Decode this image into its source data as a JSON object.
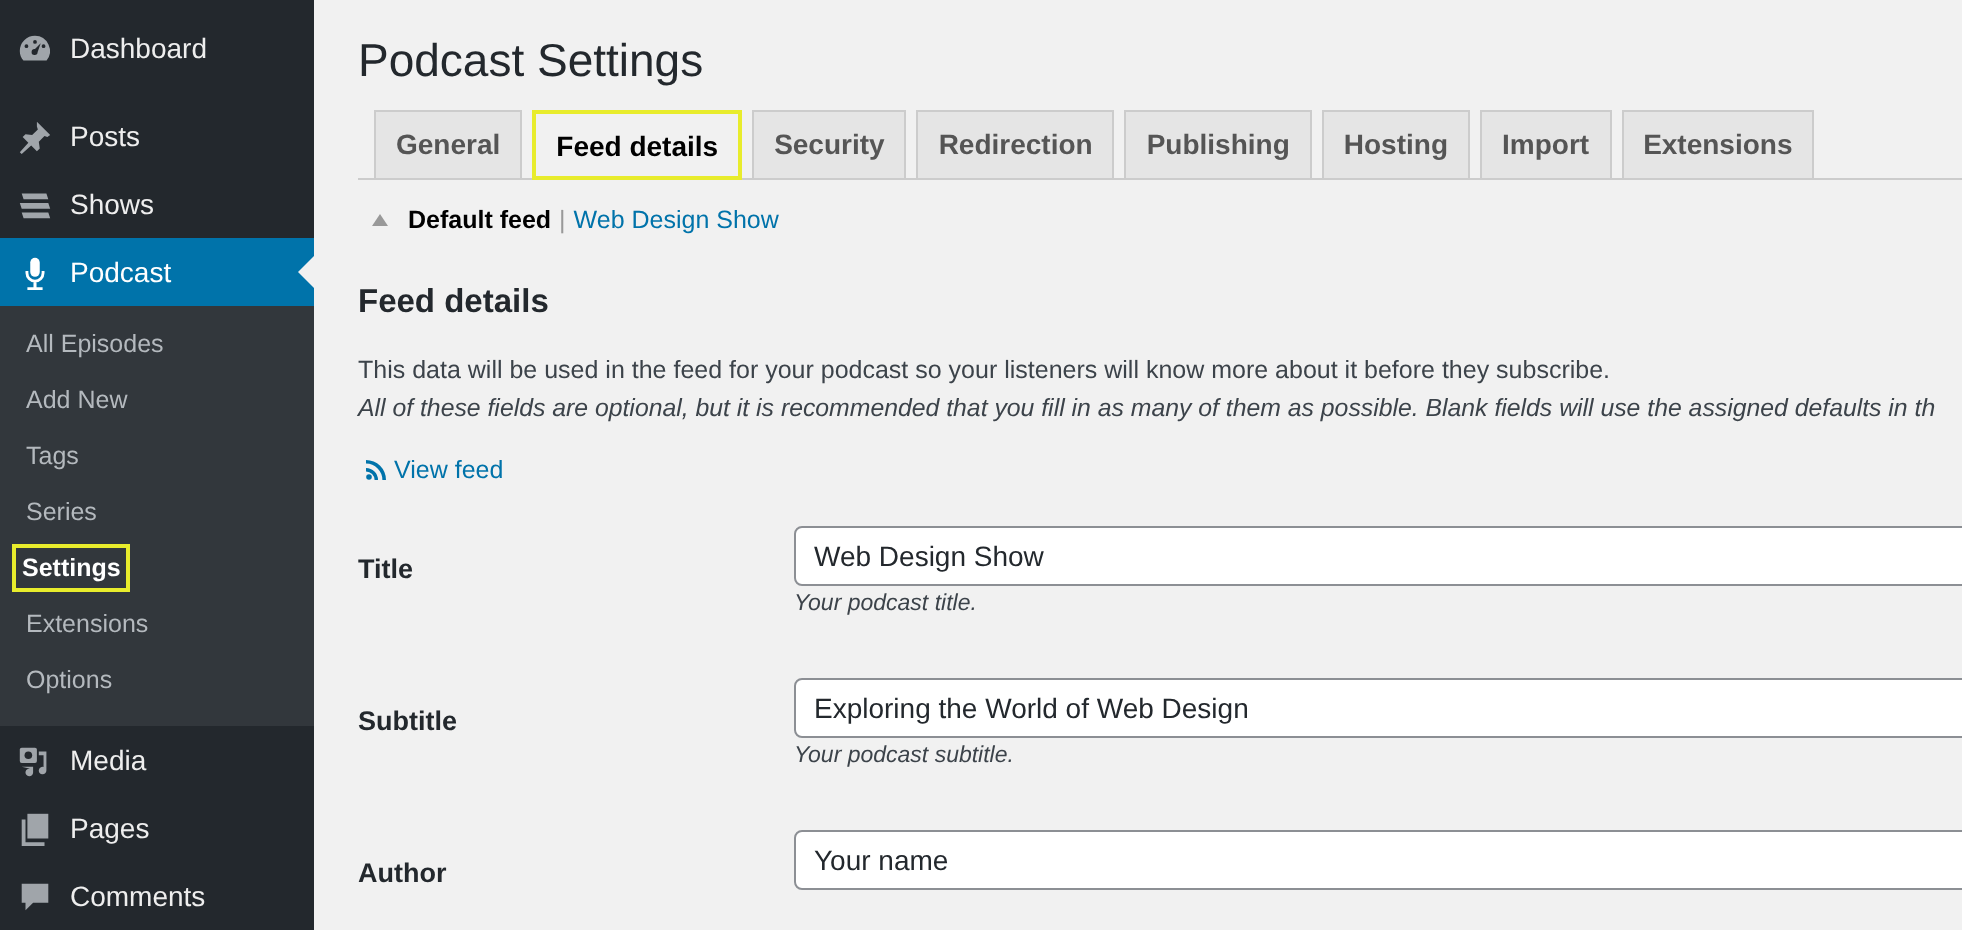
{
  "sidebar": {
    "items": [
      {
        "label": "Dashboard",
        "selected": false
      },
      {
        "label": "Posts",
        "selected": false
      },
      {
        "label": "Shows",
        "selected": false
      },
      {
        "label": "Podcast",
        "selected": true,
        "children": [
          {
            "label": "All Episodes",
            "selected": false,
            "highlighted": false
          },
          {
            "label": "Add New",
            "selected": false,
            "highlighted": false
          },
          {
            "label": "Tags",
            "selected": false,
            "highlighted": false
          },
          {
            "label": "Series",
            "selected": false,
            "highlighted": false
          },
          {
            "label": "Settings",
            "selected": true,
            "highlighted": true
          },
          {
            "label": "Extensions",
            "selected": false,
            "highlighted": false
          },
          {
            "label": "Options",
            "selected": false,
            "highlighted": false
          }
        ]
      },
      {
        "label": "Media",
        "selected": false
      },
      {
        "label": "Pages",
        "selected": false
      },
      {
        "label": "Comments",
        "selected": false
      }
    ]
  },
  "page_title": "Podcast Settings",
  "tabs": [
    {
      "label": "General",
      "selected": false,
      "highlighted": false
    },
    {
      "label": "Feed details",
      "selected": true,
      "highlighted": true
    },
    {
      "label": "Security",
      "selected": false,
      "highlighted": false
    },
    {
      "label": "Redirection",
      "selected": false,
      "highlighted": false
    },
    {
      "label": "Publishing",
      "selected": false,
      "highlighted": false
    },
    {
      "label": "Hosting",
      "selected": false,
      "highlighted": false
    },
    {
      "label": "Import",
      "selected": false,
      "highlighted": false
    },
    {
      "label": "Extensions",
      "selected": false,
      "highlighted": false
    }
  ],
  "feed_separator": "|",
  "feed_switcher": [
    {
      "label": "Default feed",
      "selected": true
    },
    {
      "label": "Web Design Show",
      "selected": false
    }
  ],
  "section_title": "Feed details",
  "description": "This data will be used in the feed for your podcast so your listeners will know more about it before they subscribe.",
  "note": "All of these fields are optional, but it is recommended that you fill in as many of them as possible. Blank fields will use the assigned defaults in th",
  "view_feed_link": "View feed",
  "fields": [
    {
      "label": "Title",
      "value": "Web Design Show",
      "hint": "Your podcast title."
    },
    {
      "label": "Subtitle",
      "value": "Exploring the World of Web Design",
      "hint": "Your podcast subtitle."
    },
    {
      "label": "Author",
      "value": "Your name"
    }
  ]
}
